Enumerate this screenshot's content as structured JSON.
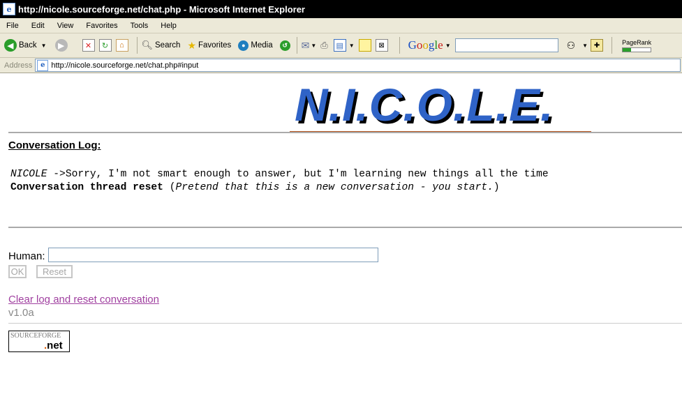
{
  "window": {
    "title": "http://nicole.sourceforge.net/chat.php - Microsoft Internet Explorer"
  },
  "menubar": [
    "File",
    "Edit",
    "View",
    "Favorites",
    "Tools",
    "Help"
  ],
  "toolbar": {
    "back_label": "Back",
    "search_label": "Search",
    "favorites_label": "Favorites",
    "media_label": "Media",
    "google_label": "Google",
    "pagerank_label": "PageRank",
    "pagerank_fill": 0.3
  },
  "address": {
    "label": "Address",
    "url": "http://nicole.sourceforge.net/chat.php#input"
  },
  "page": {
    "logo_text": "N.I.C.O.L.E.",
    "heading": "Conversation Log:",
    "log_line1_name": "NICOLE",
    "log_line1_text": " ->Sorry, I'm not smart enough to answer, but I'm learning new things all the time",
    "log_line2_bold": "Conversation thread reset",
    "log_line2_open": " (",
    "log_line2_italic": "Pretend that this is a new conversation - you start.",
    "log_line2_close": ")",
    "human_label": "Human:",
    "human_input_value": "",
    "ok_label": "OK",
    "reset_label": "Reset",
    "clear_link": "Clear log and reset conversation",
    "version": "v1.0a",
    "sf_top": "SOURCEFORGE",
    "sf_dot": ".",
    "sf_bottom": "net"
  },
  "colors": {
    "logo_blue": "#2f63c7",
    "logo_underline": "#b5541d",
    "link_visited": "#a040a0"
  }
}
